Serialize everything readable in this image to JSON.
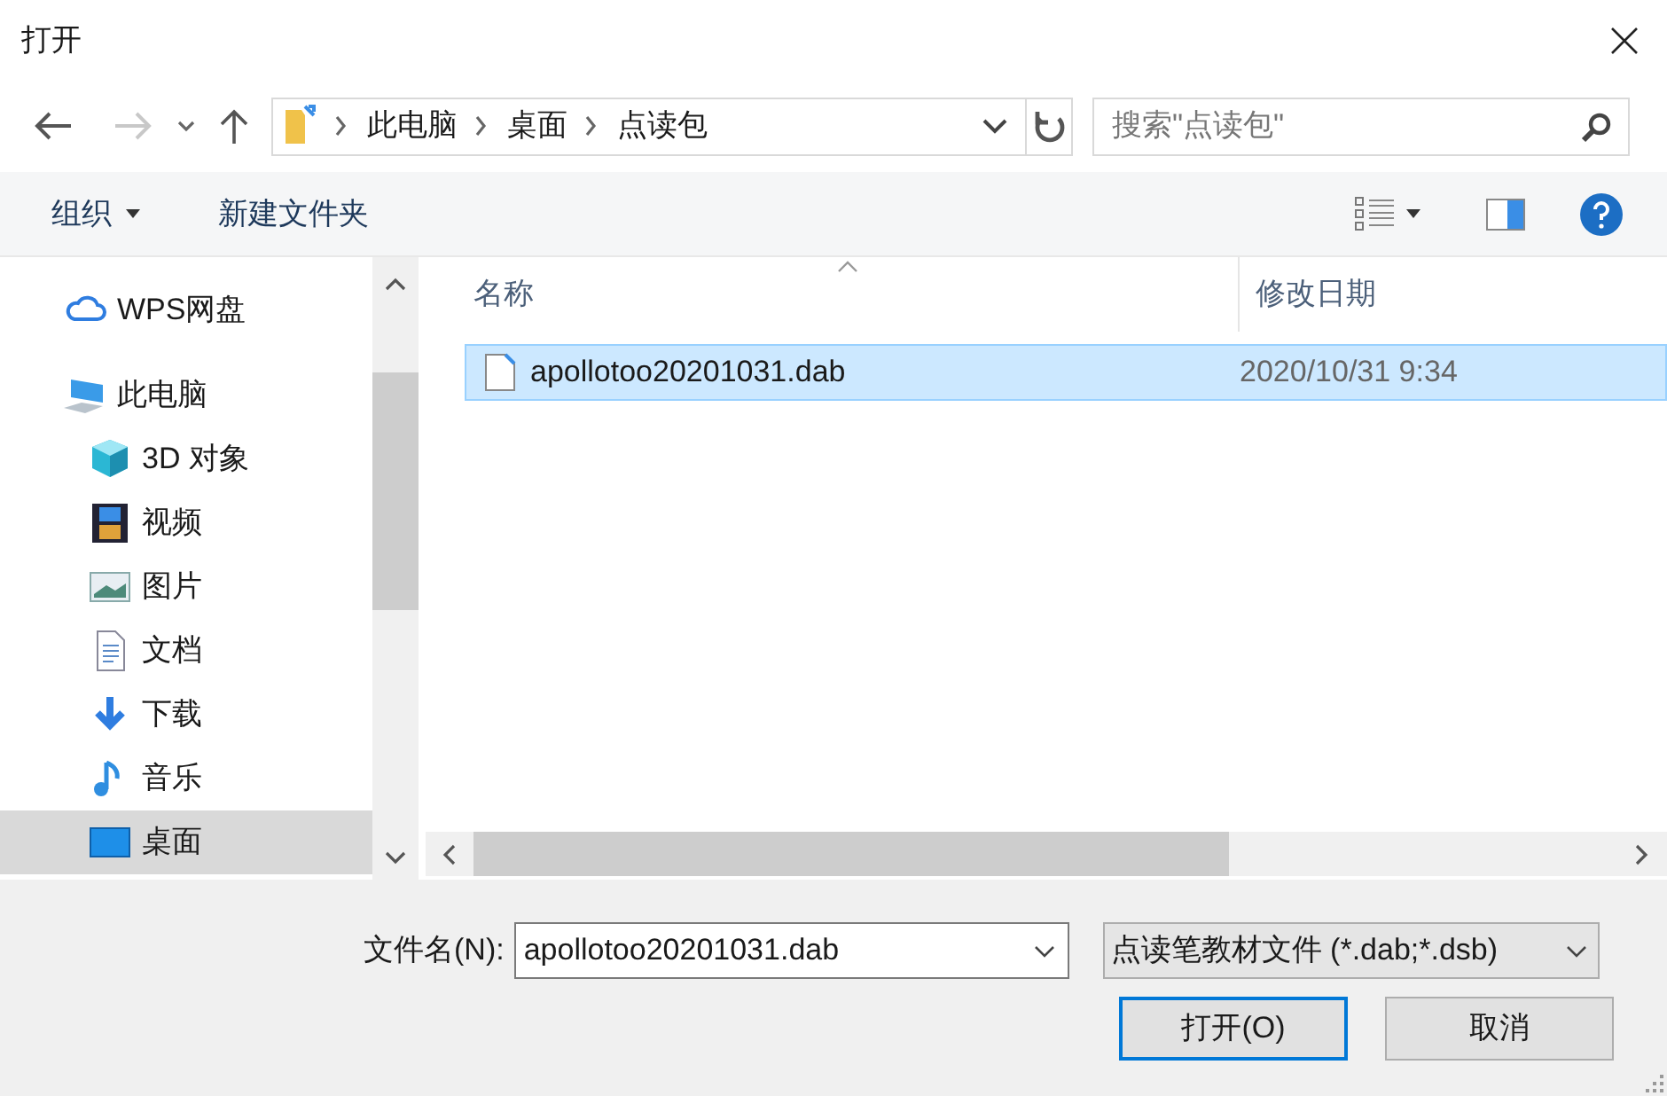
{
  "window": {
    "title": "打开"
  },
  "address": {
    "path": [
      "此电脑",
      "桌面",
      "点读包"
    ]
  },
  "search": {
    "placeholder": "搜索\"点读包\""
  },
  "toolbar": {
    "organize": "组织",
    "new_folder": "新建文件夹"
  },
  "sidebar": {
    "items": [
      {
        "label": "WPS网盘",
        "kind": "cloud",
        "selected": false
      },
      {
        "label": "此电脑",
        "kind": "pc",
        "selected": false,
        "children": [
          {
            "label": "3D 对象",
            "kind": "cube",
            "selected": false
          },
          {
            "label": "视频",
            "kind": "film",
            "selected": false
          },
          {
            "label": "图片",
            "kind": "image",
            "selected": false
          },
          {
            "label": "文档",
            "kind": "doc",
            "selected": false
          },
          {
            "label": "下载",
            "kind": "download",
            "selected": false
          },
          {
            "label": "音乐",
            "kind": "music",
            "selected": false
          },
          {
            "label": "桌面",
            "kind": "desktop",
            "selected": true
          }
        ]
      }
    ]
  },
  "table": {
    "columns": [
      "名称",
      "修改日期"
    ],
    "rows": [
      {
        "name": "apollotoo20201031.dab",
        "modified": "2020/10/31 9:34",
        "selected": true
      }
    ]
  },
  "footer": {
    "filename_label": "文件名(N):",
    "filename": "apollotoo20201031.dab",
    "filter": "点读笔教材文件 (*.dab;*.dsb)",
    "open": "打开(O)",
    "cancel": "取消"
  }
}
